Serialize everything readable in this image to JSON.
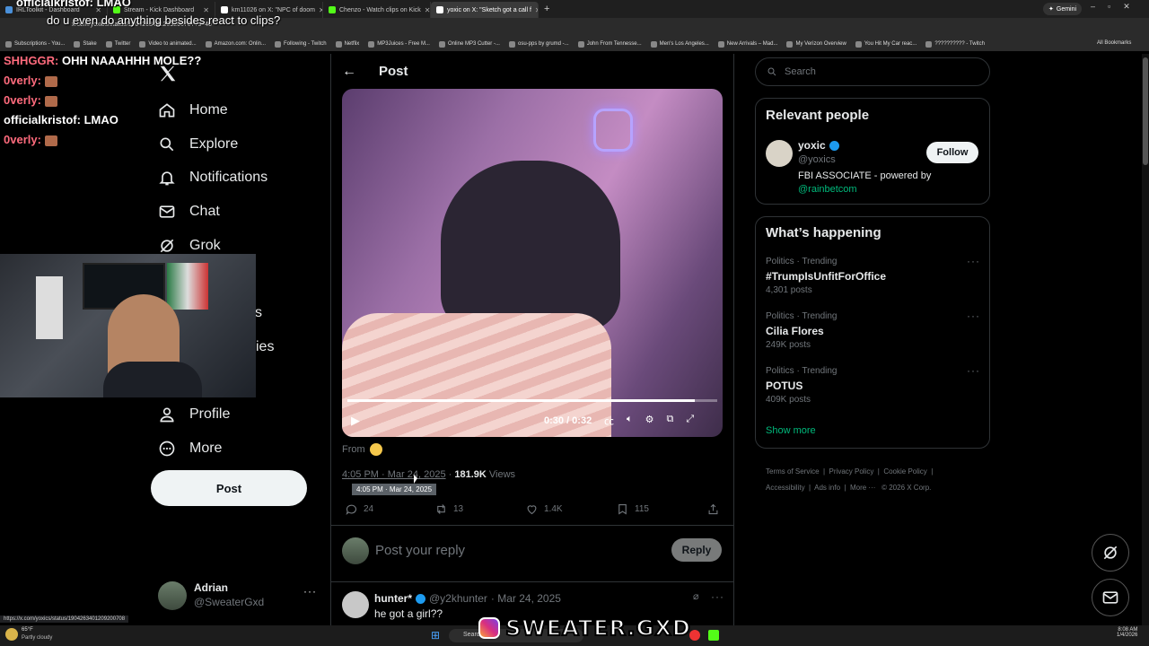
{
  "browser": {
    "tabs": [
      {
        "label": "IRLToolkit - Dashboard",
        "color": "#4a90d9"
      },
      {
        "label": "Stream - Kick Dashboard",
        "color": "#53fc18"
      },
      {
        "label": "km11026 on X: \"NPC of doom",
        "color": "#ffffff"
      },
      {
        "label": "Chenzo - Watch clips on Kick",
        "color": "#53fc18"
      },
      {
        "label": "yoxic on X: \"Sketch got a call f",
        "color": "#ffffff",
        "active": true
      }
    ],
    "gemini_label": "Gemini",
    "url": "x.com/yoxics/status/1904263401209200707?s=46",
    "bookmarks": [
      "Subscriptions - You...",
      "Stake",
      "Twitter",
      "Video to animated...",
      "Amazon.com: Onlin...",
      "Following - Twitch",
      "Netflix",
      "MP3Juices - Free M...",
      "Online MP3 Cutter -...",
      "osu-pps by grumd -...",
      "John From Tennesse...",
      "Men's Los Angeles...",
      "New Arrivals – Mad...",
      "My Verizon Overview",
      "You Hit My Car reac...",
      "?????????? - Twitch"
    ],
    "all_bookmarks": "All Bookmarks"
  },
  "chat": {
    "top_partial_user": "officialkristof:",
    "top_partial_msg": "LMAO",
    "question": "do u even do anything besides react to clips?",
    "messages": [
      {
        "user": "SHHGGR:",
        "text": "OHH NAAAHHH MOLE??",
        "color": "#ff6b7d"
      },
      {
        "user": "0verly:",
        "text": "",
        "color": "#ff6b7d",
        "emote": true
      },
      {
        "user": "0verly:",
        "text": "",
        "color": "#ff6b7d",
        "emote": true
      },
      {
        "user": "officialkristof:",
        "text": "LMAO",
        "color": "#ffffff"
      },
      {
        "user": "0verly:",
        "text": "",
        "color": "#ff6b7d",
        "emote": true
      }
    ]
  },
  "nav": {
    "items": [
      {
        "label": "Home",
        "icon": "home-icon"
      },
      {
        "label": "Explore",
        "icon": "search-icon"
      },
      {
        "label": "Notifications",
        "icon": "bell-icon"
      },
      {
        "label": "Chat",
        "icon": "mail-icon"
      },
      {
        "label": "Grok",
        "icon": "grok-icon"
      },
      {
        "label": "Profile",
        "icon": "person-icon"
      },
      {
        "label": "More",
        "icon": "more-circle-icon"
      }
    ],
    "partial_labels": [
      "s",
      "ies"
    ],
    "post_button": "Post",
    "account": {
      "name": "Adrian",
      "handle": "@SweaterGxd"
    }
  },
  "post": {
    "header": "Post",
    "video_time": "0:30 / 0:32",
    "video_progress": 0.94,
    "from_label": "From",
    "timestamp": "4:05 PM · Mar 24, 2025",
    "views_count": "181.9K",
    "views_label": "Views",
    "tooltip": "4:05 PM · Mar 24, 2025",
    "actions": {
      "replies": "24",
      "reposts": "13",
      "likes": "1.4K",
      "bookmarks": "115"
    },
    "reply_placeholder": "Post your reply",
    "reply_button": "Reply"
  },
  "reply": {
    "name": "hunter*",
    "handle": "@y2khunter",
    "date": "· Mar 24, 2025",
    "text": "he got a girl??"
  },
  "right": {
    "search_placeholder": "Search",
    "relevant_title": "Relevant people",
    "person": {
      "name": "yoxic",
      "handle": "@yoxics",
      "bio": "FBI ASSOCIATE - powered by",
      "link": "@rainbetcom",
      "follow": "Follow"
    },
    "happening_title": "What’s happening",
    "trends": [
      {
        "meta": "Politics · Trending",
        "title": "#TrumpIsUnfitForOffice",
        "count": "4,301 posts"
      },
      {
        "meta": "Politics · Trending",
        "title": "Cilia Flores",
        "count": "249K posts"
      },
      {
        "meta": "Politics · Trending",
        "title": "POTUS",
        "count": "409K posts"
      }
    ],
    "show_more": "Show more",
    "footer": [
      "Terms of Service",
      "Privacy Policy",
      "Cookie Policy",
      "Accessibility",
      "Ads info",
      "More ···",
      "© 2026 X Corp."
    ]
  },
  "overlay": {
    "watermark": "SWEATER.GXD"
  },
  "statusbar": {
    "url": "https://x.com/yoxics/status/1904263401209200708"
  },
  "taskbar": {
    "weather_temp": "65°F",
    "weather_desc": "Partly cloudy",
    "search": "Search",
    "time": "8:08 AM",
    "date": "1/4/2026"
  },
  "colors": {
    "accent": "#1d9bf0",
    "link": "#1d9bf0",
    "trend_link": "#00ba7c",
    "border": "#2f3336",
    "muted": "#71767b"
  }
}
